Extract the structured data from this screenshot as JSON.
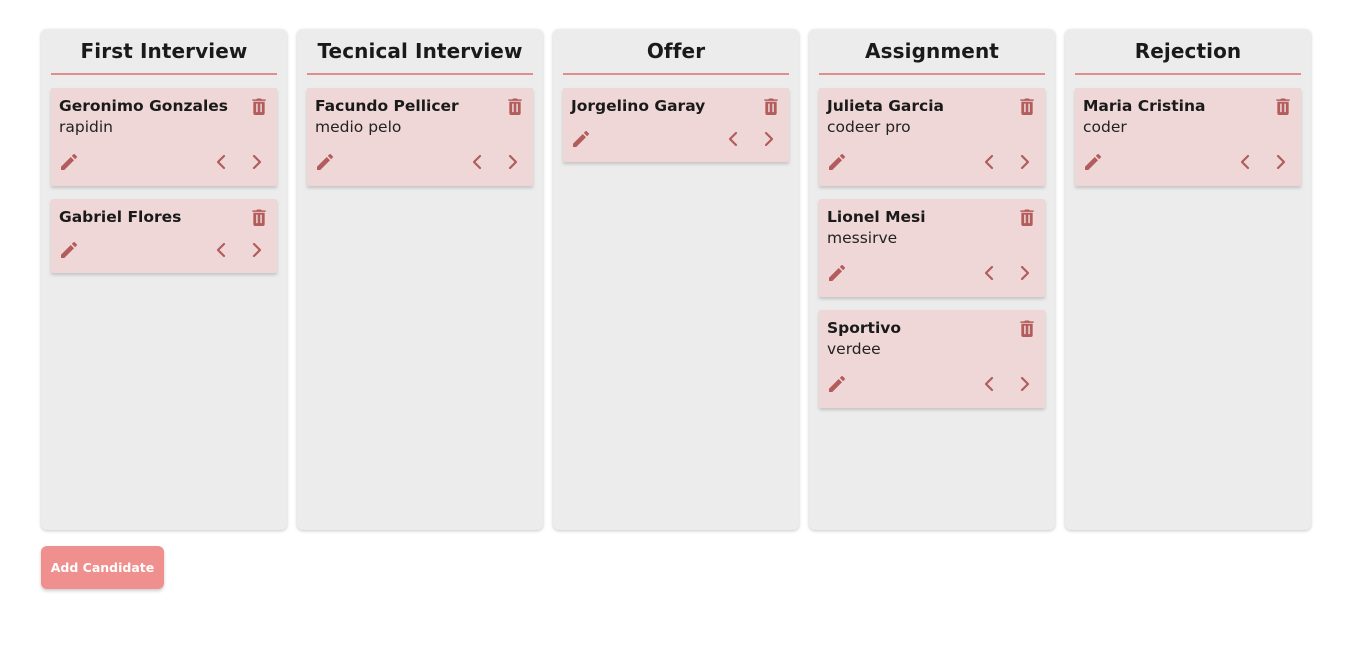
{
  "colors": {
    "accent": "#f0908e",
    "icon": "#b35c5c",
    "card": "#f0d7d7",
    "column": "#ececec",
    "divider": "#e08d8d"
  },
  "columns": [
    {
      "title": "First Interview",
      "cards": [
        {
          "name": "Geronimo Gonzales",
          "role": "rapidin"
        },
        {
          "name": "Gabriel Flores",
          "role": ""
        }
      ]
    },
    {
      "title": "Tecnical Interview",
      "cards": [
        {
          "name": "Facundo Pellicer",
          "role": "medio pelo"
        }
      ]
    },
    {
      "title": "Offer",
      "cards": [
        {
          "name": "Jorgelino Garay",
          "role": ""
        }
      ]
    },
    {
      "title": "Assignment",
      "cards": [
        {
          "name": "Julieta Garcia",
          "role": "codeer pro"
        },
        {
          "name": "Lionel Mesi",
          "role": "messirve"
        },
        {
          "name": "Sportivo",
          "role": "verdee"
        }
      ]
    },
    {
      "title": "Rejection",
      "cards": [
        {
          "name": "Maria Cristina",
          "role": "coder"
        }
      ]
    }
  ],
  "icons": {
    "delete": "trash-icon",
    "edit": "pencil-icon",
    "move_left": "chevron-left-icon",
    "move_right": "chevron-right-icon"
  },
  "add_button_label": "Add Candidate"
}
